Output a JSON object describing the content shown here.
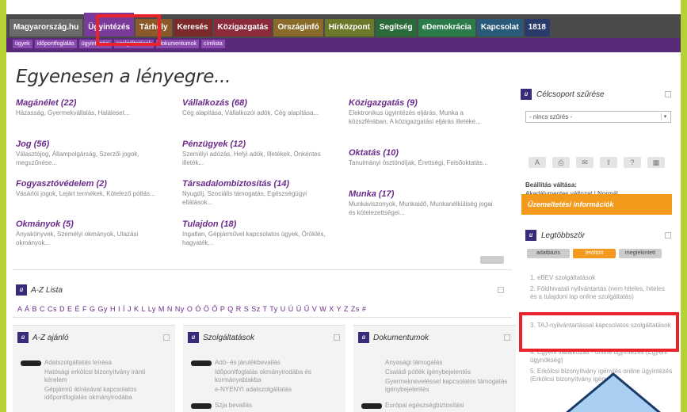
{
  "nav": {
    "tabs": [
      {
        "label": "Magyarország.hu",
        "color": "#6b6b6b"
      },
      {
        "label": "Ügyintézés",
        "color": "#7a3a9a",
        "active": true
      },
      {
        "label": "Tárhely",
        "color": "#8a5a2a"
      },
      {
        "label": "Keresés",
        "color": "#7a2a2a"
      },
      {
        "label": "Közigazgatás",
        "color": "#8a2a3a"
      },
      {
        "label": "Országinfó",
        "color": "#8a6a2a"
      },
      {
        "label": "Hírközpont",
        "color": "#6a7a2a"
      },
      {
        "label": "Segítség",
        "color": "#2a6a3a"
      },
      {
        "label": "eDemokrácia",
        "color": "#2a7a4a"
      },
      {
        "label": "Kapcsolat",
        "color": "#2a5a7a"
      },
      {
        "label": "1818",
        "color": "#2a3a6a"
      }
    ],
    "subtabs": [
      "ügyek",
      "időpontfoglalás",
      "ügyintézési",
      "szolgáltatások",
      "dokumentumok",
      "címlista"
    ]
  },
  "main": {
    "headline": "Egyenesen a lényegre...",
    "categories": [
      {
        "title": "Magánélet (22)",
        "desc": "Házasság, Gyermekvállalás, Haláleset..."
      },
      {
        "title": "Jog (56)",
        "desc": "Választójog, Állampolgárság, Szerzői jogok, megszűnése..."
      },
      {
        "title": "Fogyasztóvédelem (2)",
        "desc": "Vásárlói jogok, Lejárt termékek, Kötelező pótlás..."
      },
      {
        "title": "Okmányok (5)",
        "desc": "Anyakönyvek, Személyi okmányok, Utazási okmányok..."
      },
      {
        "title": "Vállalkozás (68)",
        "desc": "Cég alapítása, Vállalkozói adók, Cég alapítása..."
      },
      {
        "title": "Pénzügyek (12)",
        "desc": "Személyi adózás, Helyi adók, Illetékek, Önkéntes illeték..."
      },
      {
        "title": "Társadalombiztosítás (14)",
        "desc": "Nyugdíj, Szociális támogatás, Egészségügyi ellátások..."
      },
      {
        "title": "Tulajdon (18)",
        "desc": "Ingatlan, Gépjárművel kapcsolatos ügyek, Öröklés, hagyaték..."
      },
      {
        "title": "Közigazgatás (9)",
        "desc": "Elektronikus ügyintézés eljárás, Munka a közszférában, A közigazgatási eljárás illetéke..."
      },
      {
        "title": "Oktatás (10)",
        "desc": "Tanulmányi ösztöndíjak, Érettségi, Felsőoktatás..."
      },
      {
        "title": "Munka (17)",
        "desc": "Munkaviszonyok, Munkaidő, Munkanélküliség jogai és kötelezettségei..."
      }
    ],
    "az_list": {
      "title": "A-Z Lista",
      "letters": "A Á B C Cs D E É F G Gy H I Í J K L Ly M N Ny O Ó Ö Ő P Q R S Sz T Ty U Ú Ü Ű V W X Y Z Zs #"
    },
    "boxes": [
      {
        "title": "A-Z ajánló",
        "items": [
          "Adatszolgáltatás leírása",
          "Hatósági erkölcsi bizonyítvány iránti kérelem",
          "Gépjármű átírásával kapcsolatos időpontfoglalás okmányirodába"
        ]
      },
      {
        "title": "Szolgáltatások",
        "items": [
          "Adó- és járulékbevallás",
          "Időpontfoglalás okmányirodába és kormányablakba",
          "e-NYENYI adatszolgáltatás",
          "Szja bevallás"
        ]
      },
      {
        "title": "Dokumentumok",
        "items": [
          "Anyasági támogatás",
          "Családi pótlék igénybejelentés",
          "Gyermekneveléssel kapcsolatos támogatás igénybejelentés",
          "Európai egészségbiztosítási"
        ]
      }
    ]
  },
  "side": {
    "target_filter": {
      "title": "Célcsoport szűrése",
      "select_value": "- nincs szűrés -"
    },
    "tools": [
      "A",
      "⎙",
      "✉",
      "⇧",
      "?",
      "▦"
    ],
    "view_label": "Beállítás váltása:",
    "view_value": "Akadálymentes változat | Normál",
    "orange": "Üzemeltetési információk",
    "popular": {
      "title": "Legtöbbször",
      "tabs": [
        "adatbázis",
        "letöltött",
        "megtekintett"
      ],
      "items": [
        "1. eBEV szolgáltatások",
        "2. Földhivatali nyilvántartás (nem hiteles, hiteles és a tulajdoni lap online szolgáltatás)",
        "3. TAJ-nyilvántartással kapcsolatos szolgáltatások",
        "4. Egyéni vállalkozás - online ügyintézés (Egyéni ügynökség)",
        "5. Erkölcsi bizonyítvány igénylés online ügyintézés (Erkölcsi bizonyítvány igénylés)"
      ]
    }
  },
  "colors": {
    "accent": "#6a2a8a",
    "highlight": "#e8232b",
    "orange": "#f39a1d",
    "frame": "#b5d334",
    "arrow": "#a9d0f2"
  }
}
